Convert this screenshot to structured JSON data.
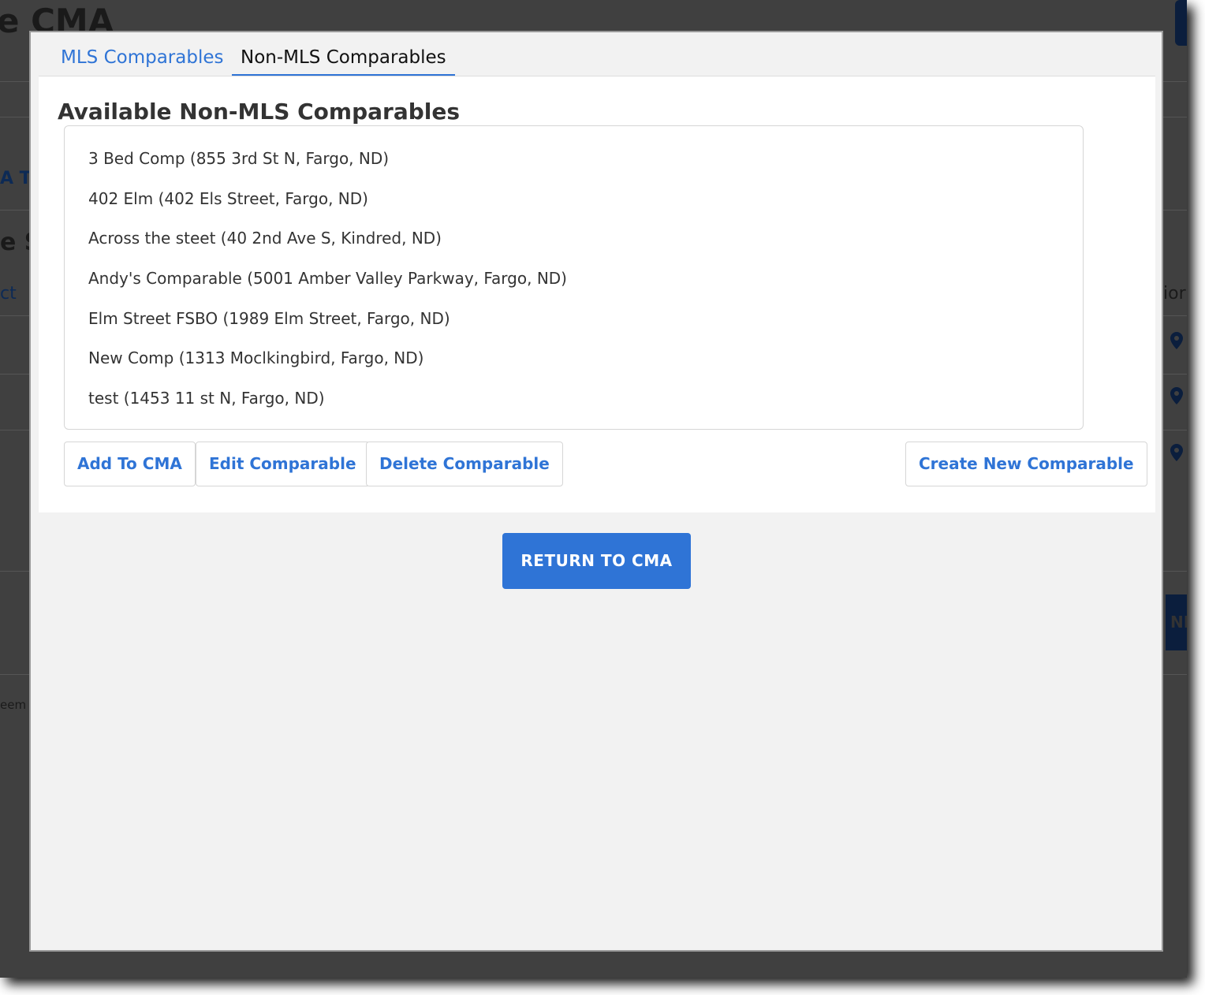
{
  "background": {
    "heading_fragment": "e CMA",
    "fragment_1": "A T",
    "fragment_2": "e S",
    "fragment_3": "ct",
    "fragment_4": "eem",
    "fragment_right_1": "ior",
    "fragment_right_2": "NI"
  },
  "tabs": [
    {
      "label": "MLS Comparables",
      "active": false
    },
    {
      "label": "Non-MLS Comparables",
      "active": true
    }
  ],
  "panel": {
    "title": "Available Non-MLS Comparables",
    "comparables": [
      "3 Bed Comp (855 3rd St N, Fargo, ND)",
      "402 Elm (402 Els Street, Fargo, ND)",
      "Across the steet (40 2nd Ave S, Kindred, ND)",
      "Andy's Comparable (5001 Amber Valley Parkway, Fargo, ND)",
      "Elm Street FSBO (1989 Elm Street, Fargo, ND)",
      "New Comp (1313 Moclkingbird, Fargo, ND)",
      "test (1453 11 st N, Fargo, ND)"
    ],
    "buttons": {
      "add": "Add To CMA",
      "edit": "Edit Comparable",
      "delete": "Delete Comparable",
      "create": "Create New Comparable"
    }
  },
  "return_button": "RETURN TO CMA",
  "colors": {
    "accent": "#2f74d6",
    "overlay": "#404040",
    "modal_bg": "#f2f2f2"
  }
}
